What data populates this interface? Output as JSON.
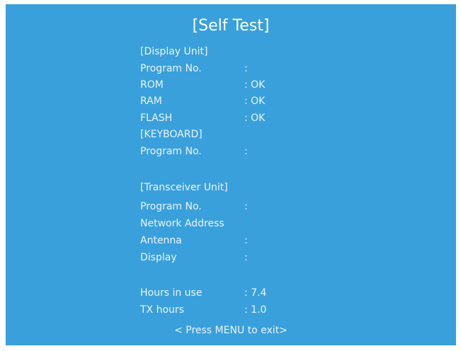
{
  "screen": {
    "title": "[Self Test]",
    "footer": "< Press MENU to exit>"
  },
  "rows": [
    {
      "label": "[Display Unit]",
      "value": ""
    },
    {
      "label": "Program No.",
      "value": ":"
    },
    {
      "label": "ROM",
      "value": ": OK"
    },
    {
      "label": "RAM",
      "value": ": OK"
    },
    {
      "label": "FLASH",
      "value": ": OK"
    },
    {
      "label": "[KEYBOARD]",
      "value": ""
    },
    {
      "label": "Program No.",
      "value": ":"
    },
    {
      "label": "[Transceiver Unit]",
      "value": ""
    },
    {
      "label": "Program No.",
      "value": ":"
    },
    {
      "label": "Network Address",
      "value": ""
    },
    {
      "label": "Antenna",
      "value": ":"
    },
    {
      "label": "Display",
      "value": ":"
    },
    {
      "label": "Hours in use",
      "value": ": 7.4"
    },
    {
      "label": "TX hours",
      "value": ": 1.0"
    }
  ],
  "colors": {
    "background": "#3aa0dc",
    "text": "#ffffff"
  }
}
